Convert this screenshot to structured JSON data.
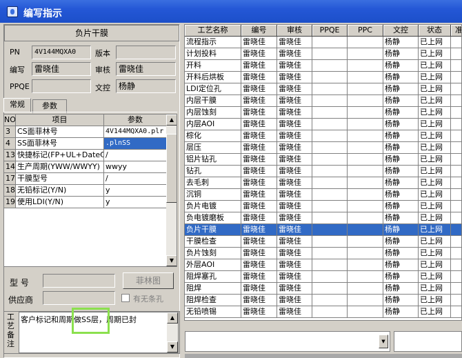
{
  "window": {
    "title": "编写指示"
  },
  "header": {
    "title": "负片干膜"
  },
  "form": {
    "pn_label": "PN",
    "pn_value": "4V144MQXA0",
    "version_label": "版本",
    "version_value": "",
    "author_label": "编写",
    "author_value": "雷晓佳",
    "reviewer_label": "审核",
    "reviewer_value": "雷晓佳",
    "ppqe_label": "PPQE",
    "ppqe_value": "",
    "control_label": "文控",
    "control_value": "杨静"
  },
  "tabs": [
    {
      "label": "常规"
    },
    {
      "label": "参数"
    }
  ],
  "param_grid": {
    "headers": [
      "NO",
      "项目",
      "参数"
    ],
    "rows": [
      {
        "no": "3",
        "item": "CS面菲林号",
        "value": "4V144MQXA0.plr"
      },
      {
        "no": "4",
        "item": "SS面菲林号",
        "value": ".plnSS"
      },
      {
        "no": "13",
        "item": "快捷标记(FP+UL+DateC",
        "value": "/"
      },
      {
        "no": "14",
        "item": "生产周期(YWW/WWYY)",
        "value": "wwyy"
      },
      {
        "no": "17",
        "item": "干膜型号",
        "value": "/"
      },
      {
        "no": "18",
        "item": "无铅标记(Y/N)",
        "value": "y"
      },
      {
        "no": "19",
        "item": "使用LDI(Y/N)",
        "value": "y"
      }
    ]
  },
  "model": {
    "label": "型  号",
    "value": "",
    "button": "菲林图"
  },
  "supplier": {
    "label": "供应商",
    "value": "",
    "checkbox_label": "有无条孔"
  },
  "memo": {
    "label": "工艺备注",
    "text": "客户标记和周期做SS层，周期已封"
  },
  "process_grid": {
    "headers": [
      "工艺名称",
      "编号",
      "审核",
      "PPQE",
      "PPC",
      "文控",
      "状态",
      "准"
    ],
    "rows": [
      {
        "name": "流程指示",
        "author": "雷晓佳",
        "reviewer": "雷晓佳",
        "ppqe": "",
        "ppc": "",
        "control": "杨静",
        "status": "已上网"
      },
      {
        "name": "计划投料",
        "author": "雷晓佳",
        "reviewer": "雷晓佳",
        "ppqe": "",
        "ppc": "",
        "control": "杨静",
        "status": "已上网"
      },
      {
        "name": "开料",
        "author": "雷晓佳",
        "reviewer": "雷晓佳",
        "ppqe": "",
        "ppc": "",
        "control": "杨静",
        "status": "已上网"
      },
      {
        "name": "开料后烘板",
        "author": "雷晓佳",
        "reviewer": "雷晓佳",
        "ppqe": "",
        "ppc": "",
        "control": "杨静",
        "status": "已上网"
      },
      {
        "name": "LDI定位孔",
        "author": "雷晓佳",
        "reviewer": "雷晓佳",
        "ppqe": "",
        "ppc": "",
        "control": "杨静",
        "status": "已上网"
      },
      {
        "name": "内层干膜",
        "author": "雷晓佳",
        "reviewer": "雷晓佳",
        "ppqe": "",
        "ppc": "",
        "control": "杨静",
        "status": "已上网"
      },
      {
        "name": "内层蚀刻",
        "author": "雷晓佳",
        "reviewer": "雷晓佳",
        "ppqe": "",
        "ppc": "",
        "control": "杨静",
        "status": "已上网"
      },
      {
        "name": "内层AOI",
        "author": "雷晓佳",
        "reviewer": "雷晓佳",
        "ppqe": "",
        "ppc": "",
        "control": "杨静",
        "status": "已上网"
      },
      {
        "name": "棕化",
        "author": "雷晓佳",
        "reviewer": "雷晓佳",
        "ppqe": "",
        "ppc": "",
        "control": "杨静",
        "status": "已上网"
      },
      {
        "name": "层压",
        "author": "雷晓佳",
        "reviewer": "雷晓佳",
        "ppqe": "",
        "ppc": "",
        "control": "杨静",
        "status": "已上网"
      },
      {
        "name": "铝片钻孔",
        "author": "雷晓佳",
        "reviewer": "雷晓佳",
        "ppqe": "",
        "ppc": "",
        "control": "杨静",
        "status": "已上网"
      },
      {
        "name": "钻孔",
        "author": "雷晓佳",
        "reviewer": "雷晓佳",
        "ppqe": "",
        "ppc": "",
        "control": "杨静",
        "status": "已上网"
      },
      {
        "name": "去毛刺",
        "author": "雷晓佳",
        "reviewer": "雷晓佳",
        "ppqe": "",
        "ppc": "",
        "control": "杨静",
        "status": "已上网"
      },
      {
        "name": "沉铜",
        "author": "雷晓佳",
        "reviewer": "雷晓佳",
        "ppqe": "",
        "ppc": "",
        "control": "杨静",
        "status": "已上网"
      },
      {
        "name": "负片电镀",
        "author": "雷晓佳",
        "reviewer": "雷晓佳",
        "ppqe": "",
        "ppc": "",
        "control": "杨静",
        "status": "已上网"
      },
      {
        "name": "负电镀磨板",
        "author": "雷晓佳",
        "reviewer": "雷晓佳",
        "ppqe": "",
        "ppc": "",
        "control": "杨静",
        "status": "已上网"
      },
      {
        "name": "负片干膜",
        "author": "雷晓佳",
        "reviewer": "雷晓佳",
        "ppqe": "",
        "ppc": "",
        "control": "杨静",
        "status": "已上网",
        "selected": true
      },
      {
        "name": "干膜检查",
        "author": "雷晓佳",
        "reviewer": "雷晓佳",
        "ppqe": "",
        "ppc": "",
        "control": "杨静",
        "status": "已上网"
      },
      {
        "name": "负片蚀刻",
        "author": "雷晓佳",
        "reviewer": "雷晓佳",
        "ppqe": "",
        "ppc": "",
        "control": "杨静",
        "status": "已上网"
      },
      {
        "name": "外层AOI",
        "author": "雷晓佳",
        "reviewer": "雷晓佳",
        "ppqe": "",
        "ppc": "",
        "control": "杨静",
        "status": "已上网"
      },
      {
        "name": "阻焊塞孔",
        "author": "雷晓佳",
        "reviewer": "雷晓佳",
        "ppqe": "",
        "ppc": "",
        "control": "杨静",
        "status": "已上网"
      },
      {
        "name": "阻焊",
        "author": "雷晓佳",
        "reviewer": "雷晓佳",
        "ppqe": "",
        "ppc": "",
        "control": "杨静",
        "status": "已上网"
      },
      {
        "name": "阻焊检查",
        "author": "雷晓佳",
        "reviewer": "雷晓佳",
        "ppqe": "",
        "ppc": "",
        "control": "杨静",
        "status": "已上网"
      },
      {
        "name": "无铅喷锡",
        "author": "雷晓佳",
        "reviewer": "雷晓佳",
        "ppqe": "",
        "ppc": "",
        "control": "杨静",
        "status": "已上网"
      }
    ]
  },
  "icons": {
    "app": "app-icon",
    "scroll_up": "scroll-up-arrow-icon",
    "scroll_down": "scroll-down-arrow-icon",
    "dropdown": "dropdown-arrow-icon"
  }
}
